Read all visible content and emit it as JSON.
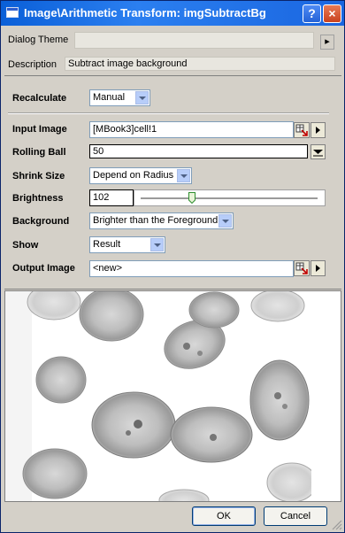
{
  "window": {
    "title": "Image\\Arithmetic Transform: imgSubtractBg",
    "help_glyph": "?",
    "close_glyph": "×"
  },
  "header": {
    "theme_label": "Dialog Theme",
    "theme_value": "",
    "theme_menu_glyph": "▸",
    "description_label": "Description",
    "description_value": "Subtract image background"
  },
  "form": {
    "recalculate": {
      "label": "Recalculate",
      "value": "Manual"
    },
    "input_image": {
      "label": "Input Image",
      "value": "[MBook3]cell!1"
    },
    "rolling_ball": {
      "label": "Rolling Ball",
      "value": "50"
    },
    "shrink_size": {
      "label": "Shrink Size",
      "value": "Depend on Radius"
    },
    "brightness": {
      "label": "Brightness",
      "value": "102",
      "level_fraction": 0.29
    },
    "background": {
      "label": "Background",
      "value": "Brighter than the Foreground"
    },
    "show": {
      "label": "Show",
      "value": "Result"
    },
    "output_image": {
      "label": "Output Image",
      "value": "<new>"
    }
  },
  "buttons": {
    "ok": "OK",
    "cancel": "Cancel"
  },
  "colors": {
    "title_bar": "#0a5fd8",
    "dialog_bg": "#d4d0c8",
    "field_border": "#7f9db9"
  },
  "icons": {
    "pick_cell": "cell-picker-icon",
    "menu_arrow": "triangle-right-icon",
    "down_arrow": "triangle-down-icon"
  }
}
